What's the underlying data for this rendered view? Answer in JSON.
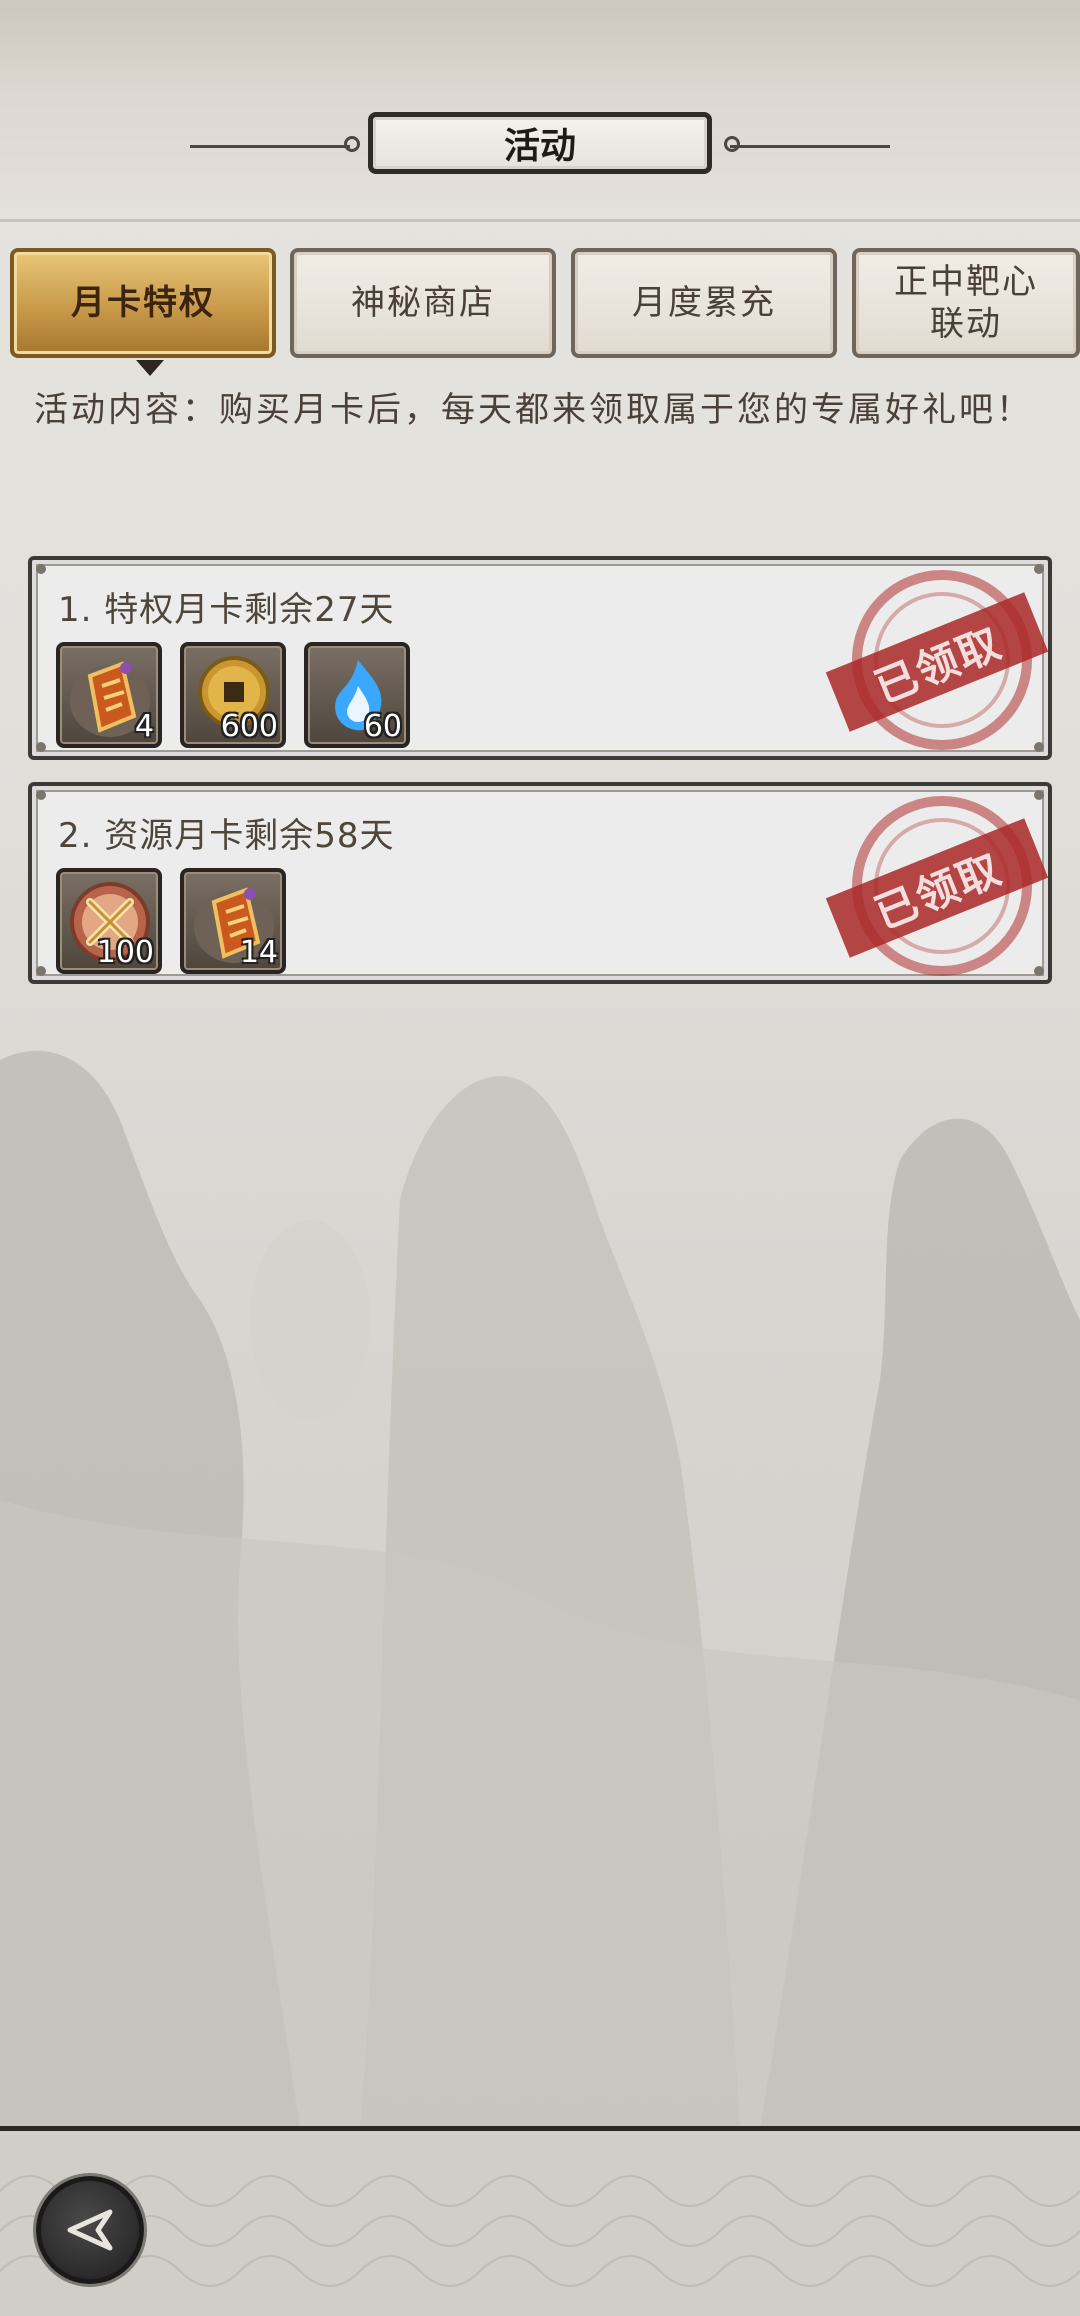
{
  "header": {
    "title": "活动"
  },
  "tabs": [
    {
      "label": "月卡特权",
      "active": true
    },
    {
      "label": "神秘商店",
      "active": false
    },
    {
      "label": "月度累充",
      "active": false
    },
    {
      "label_line1": "正中靶心",
      "label_line2": "联动",
      "active": false
    }
  ],
  "description": "活动内容：购买月卡后，每天都来领取属于您的专属好礼吧！",
  "cards": [
    {
      "title": "1.  特权月卡剩余27天",
      "items": [
        {
          "icon": "talisman-icon",
          "count": "4"
        },
        {
          "icon": "copper-coin-icon",
          "count": "600"
        },
        {
          "icon": "blue-flame-icon",
          "count": "60"
        }
      ],
      "stamp": "已领取"
    },
    {
      "title": "2.  资源月卡剩余58天",
      "items": [
        {
          "icon": "crossed-swords-icon",
          "count": "100"
        },
        {
          "icon": "talisman-icon",
          "count": "14"
        }
      ],
      "stamp": "已领取"
    }
  ],
  "footer": {
    "back_icon": "back-arrow-icon"
  },
  "colors": {
    "active_tab": "#c99a4a",
    "stamp_red": "#aa2828",
    "background": "#e2e0db"
  }
}
